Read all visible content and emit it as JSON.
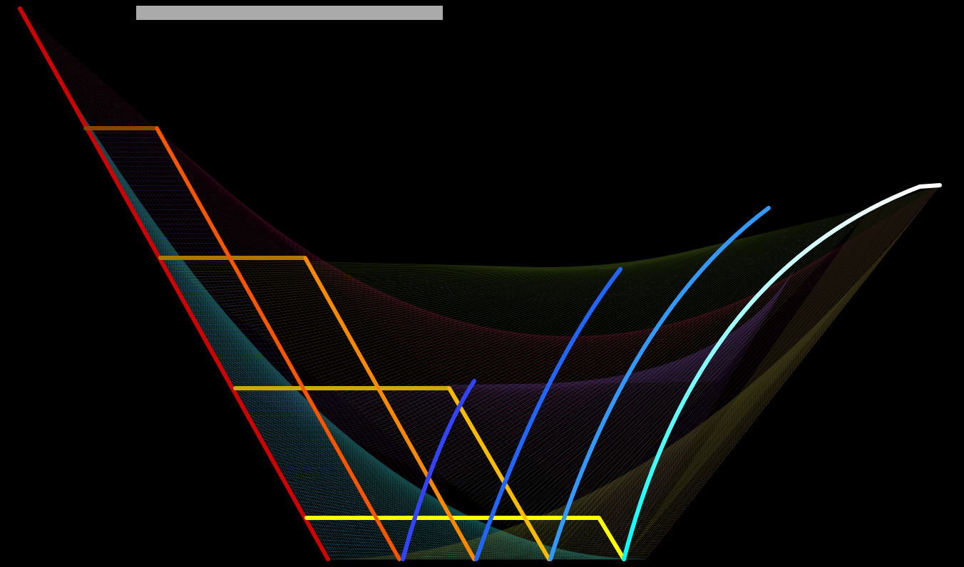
{
  "canvas": {
    "background": "#000000"
  },
  "title_bar": {
    "color": "#aaaaaa"
  },
  "palette": {
    "red": "#ff0000",
    "orange": "#ff6600",
    "yellow": "#ffff00",
    "green": "#00ff00",
    "blue": "#0000ff",
    "violet": "#8a2be2",
    "magenta": "#ff00ff",
    "cyan": "#33ffff",
    "pink": "#ff66dd",
    "white": "#ffffff"
  }
}
